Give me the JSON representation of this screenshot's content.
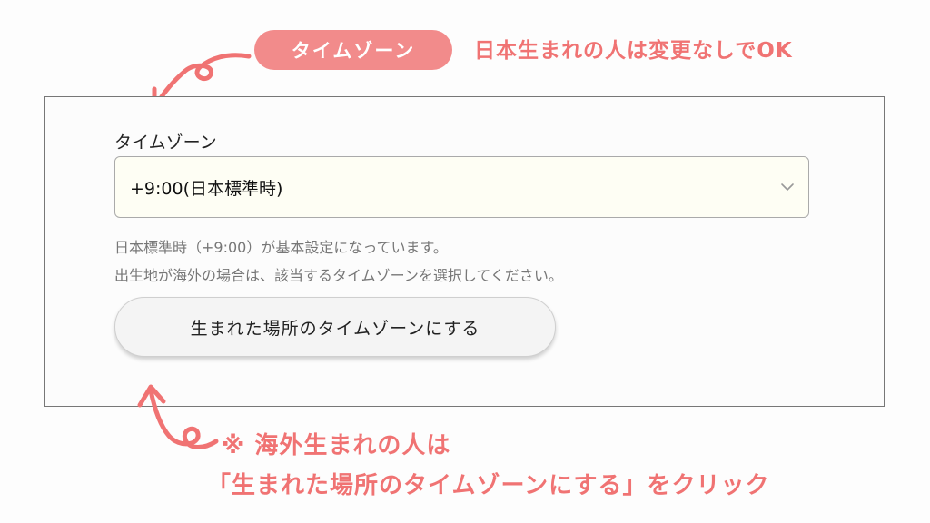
{
  "annotation_top": {
    "pill_label": "タイムゾーン",
    "note": "日本生まれの人は変更なしでOK"
  },
  "timezone_field": {
    "label": "タイムゾーン",
    "selected_value": "+9:00(日本標準時)",
    "help_line1": "日本標準時（+9:00）が基本設定になっています。",
    "help_line2": "出生地が海外の場合は、該当するタイムゾーンを選択してください。"
  },
  "birthplace_button": {
    "label": "生まれた場所のタイムゾーンにする"
  },
  "annotation_bottom": {
    "line1": "※ 海外生まれの人は",
    "line2": "「生まれた場所のタイムゾーンにする」をクリック"
  },
  "icons": {
    "select_chevron": "chevron-down-icon",
    "arrows": "curly-arrow-icon"
  },
  "colors": {
    "accent": "#f07373",
    "pill_bg": "#f28b8b",
    "select_bg": "#fefef4"
  }
}
